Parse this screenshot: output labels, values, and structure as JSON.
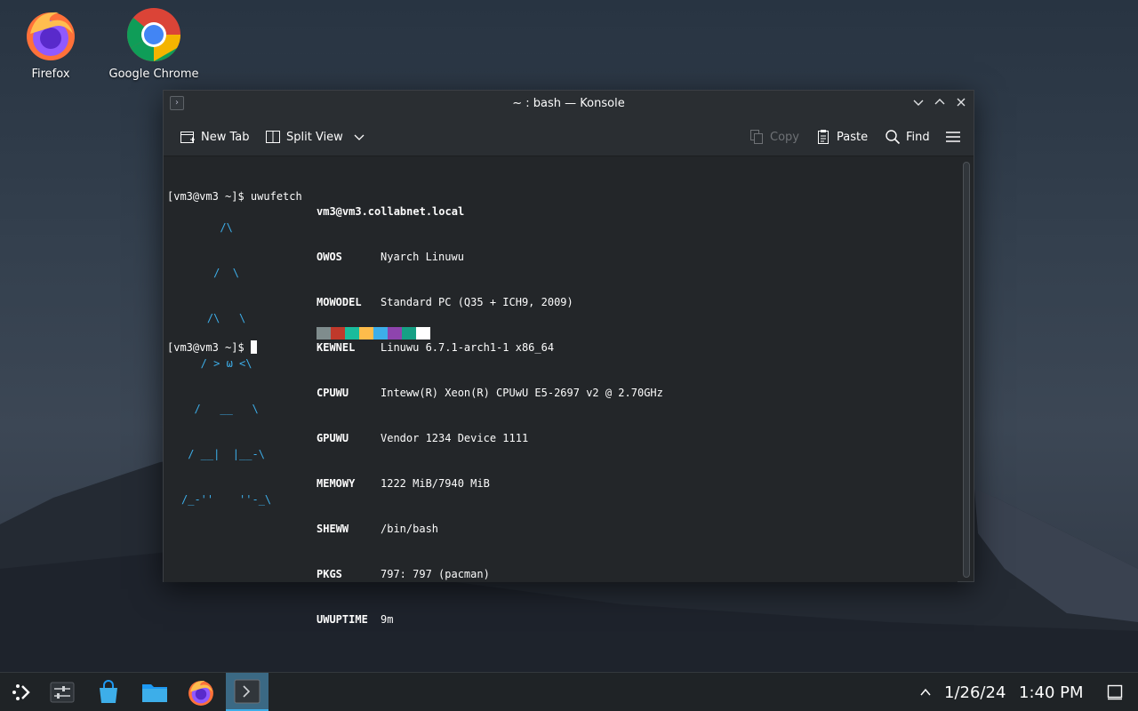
{
  "desktop": {
    "icons": [
      {
        "label": "Firefox",
        "icon": "firefox-icon"
      },
      {
        "label": "Google Chrome",
        "icon": "chrome-icon"
      }
    ]
  },
  "window": {
    "title": "~ : bash — Konsole",
    "toolbar": {
      "new_tab": "New Tab",
      "split_view": "Split View",
      "copy": "Copy",
      "paste": "Paste",
      "find": "Find"
    }
  },
  "terminal": {
    "prompt1": "[vm3@vm3 ~]$ uwufetch",
    "host": "vm3@vm3.collabnet.local",
    "logo": [
      "      /\\",
      "     /  \\",
      "    /\\   \\",
      "   / > ω <\\",
      "  /   __   \\",
      " / __|  |__-\\",
      "/_-''    ''-_\\"
    ],
    "info": [
      {
        "key": "OWOS",
        "value": "Nyarch Linuwu"
      },
      {
        "key": "MOWODEL",
        "value": "Standard PC (Q35 + ICH9, 2009)"
      },
      {
        "key": "KEWNEL",
        "value": "Linuwu 6.7.1-arch1-1 x86_64"
      },
      {
        "key": "CPUWU",
        "value": "Inteww(R) Xeon(R) CPUwU E5-2697 v2 @ 2.70GHz"
      },
      {
        "key": "GPUWU",
        "value": "Vendor 1234 Device 1111"
      },
      {
        "key": "MEMOWY",
        "value": "1222 MiB/7940 MiB"
      },
      {
        "key": "SHEWW",
        "value": "/bin/bash"
      },
      {
        "key": "PKGS",
        "value": "797: 797 (pacman)"
      },
      {
        "key": "UWUPTIME",
        "value": "9m"
      }
    ],
    "palette": [
      "#7f8c8d",
      "#c0392b",
      "#1abc9c",
      "#fdbc4b",
      "#3daee9",
      "#8e44ad",
      "#16a085",
      "#ffffff"
    ],
    "prompt2": "[vm3@vm3 ~]$ "
  },
  "taskbar": {
    "date": "1/26/24",
    "time": "1:40 PM"
  }
}
